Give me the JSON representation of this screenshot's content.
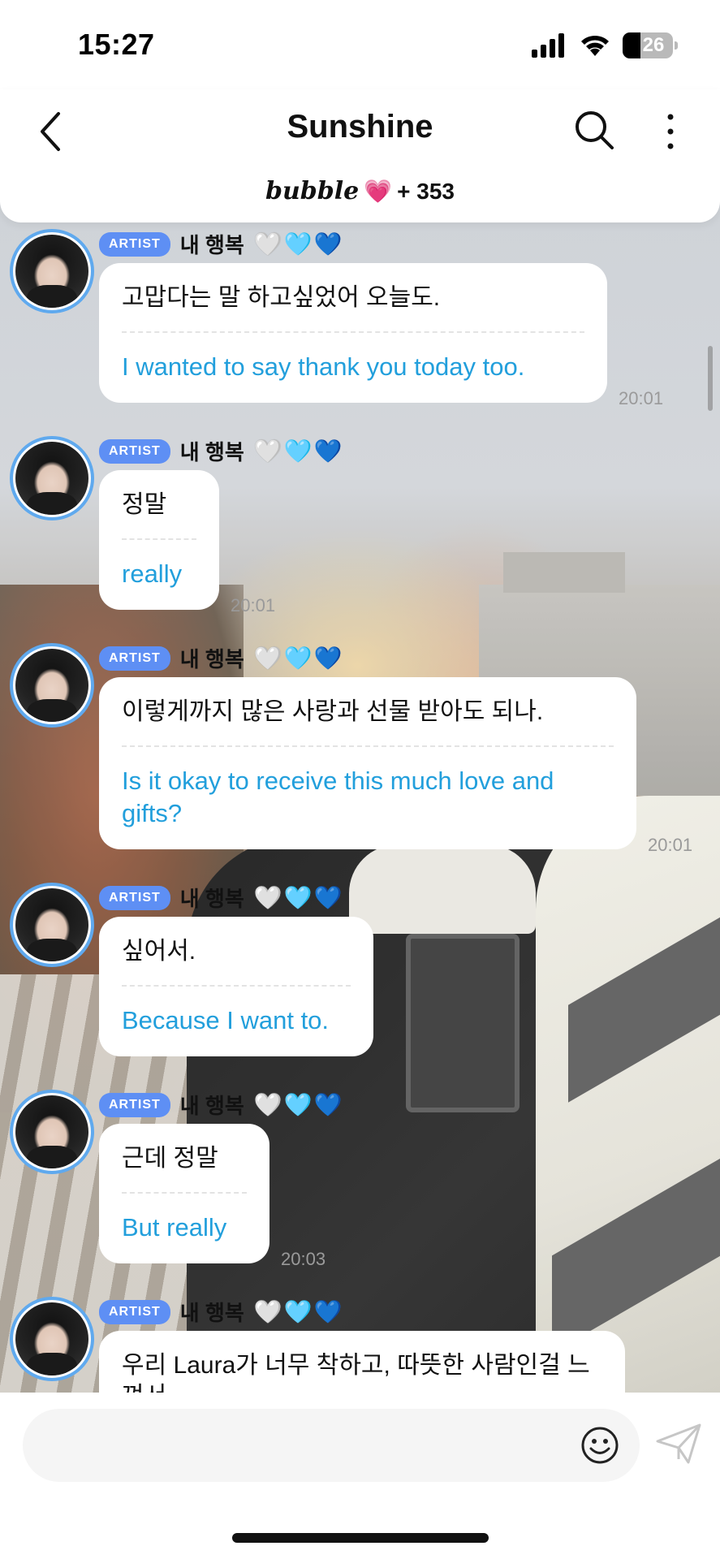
{
  "status_bar": {
    "time": "15:27",
    "battery": "26"
  },
  "header": {
    "title": "Sunshine",
    "brand": "bubble",
    "heart": "💗",
    "count": "+ 353"
  },
  "messages": [
    {
      "badge": "ARTIST",
      "nickname": "내 행복",
      "hearts": [
        "🤍",
        "🩵",
        "💙"
      ],
      "korean": "고맙다는 말 하고싶었어 오늘도.",
      "english": "I wanted to say thank you today too.",
      "time": "20:01"
    },
    {
      "badge": "ARTIST",
      "nickname": "내 행복",
      "hearts": [
        "🤍",
        "🩵",
        "💙"
      ],
      "korean": "정말",
      "english": "really",
      "time": "20:01"
    },
    {
      "badge": "ARTIST",
      "nickname": "내 행복",
      "hearts": [
        "🤍",
        "🩵",
        "💙"
      ],
      "korean": "이렇게까지 많은 사랑과 선물 받아도 되나.",
      "english": "Is it okay to receive this much love and gifts?",
      "time": "20:01"
    },
    {
      "badge": "ARTIST",
      "nickname": "내 행복",
      "hearts": [
        "🤍",
        "🩵",
        "💙"
      ],
      "korean": "싶어서.",
      "english": "Because I want to.",
      "time": ""
    },
    {
      "badge": "ARTIST",
      "nickname": "내 행복",
      "hearts": [
        "🤍",
        "🩵",
        "💙"
      ],
      "korean": "근데 정말",
      "english": "But really",
      "time": "20:03"
    },
    {
      "badge": "ARTIST",
      "nickname": "내 행복",
      "hearts": [
        "🤍",
        "🩵",
        "💙"
      ],
      "korean": "우리 Laura가 너무 착하고, 따뜻한 사람인걸 느껴서",
      "english": "",
      "time": ""
    }
  ],
  "composer": {
    "placeholder": ""
  }
}
